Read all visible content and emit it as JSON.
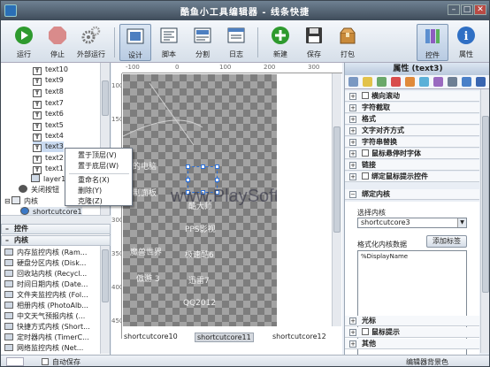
{
  "window": {
    "title": "酷鱼小工具编辑器 - 线条快捷",
    "min": "–",
    "max": "□",
    "close": "✕"
  },
  "toolbar": {
    "run": "运行",
    "stop": "停止",
    "external_run": "外部运行",
    "design": "设计",
    "script": "脚本",
    "split": "分割",
    "log": "日志",
    "new": "新建",
    "save": "保存",
    "pack": "打包",
    "controls": "控件",
    "properties": "属性",
    "colors": {
      "run": "#2e9a2e",
      "stop": "#d64040",
      "new": "#2e9a2e"
    }
  },
  "tree": {
    "items": [
      "text10",
      "text9",
      "text8",
      "text7",
      "text6",
      "text5",
      "text4",
      "text3",
      "text2",
      "text1"
    ],
    "layer": "layer1",
    "close_btn": "关闭按钮",
    "core_group": "内核",
    "core_item": "shortcutcore1"
  },
  "context_menu": {
    "top": "置于顶层(V)",
    "bottom": "置于底层(W)",
    "rename": "重命名(X)",
    "delete": "删除(Y)",
    "clone": "克隆(Z)"
  },
  "left_groups": {
    "controls": "控件",
    "cores": "内核"
  },
  "cores": [
    "内存监控内核 (Ram...",
    "硬盘分区内核 (Disk...",
    "回收站内核 (Recycl...",
    "时间日期内核 (Date...",
    "文件夹监控内核 (Fol...",
    "相册内核 (PhotoAlb...",
    "中文天气预报内核 (...",
    "快捷方式内核 (Short...",
    "定时器内核 (TimerC...",
    "网络监控内核 (Net..."
  ],
  "rulers": {
    "h": [
      "-100",
      "0",
      "100",
      "200",
      "300"
    ],
    "v": [
      "100",
      "150",
      "200",
      "250",
      "300",
      "350",
      "400",
      "450"
    ]
  },
  "canvas_texts": [
    "我的电脑",
    "控制面板",
    "魔兽世界",
    "傲游 3",
    "酷大师",
    "PPS影视",
    "极速酷6",
    "迅雷7",
    "QQ2012"
  ],
  "bottom_items": [
    "shortcutcore10",
    "shortcutcore11",
    "shortcutcore12"
  ],
  "watermark": "www.PlaySoft.com",
  "properties": {
    "title": "属性 (text3)",
    "rows": [
      "横向滚动",
      "字符截取",
      "格式",
      "文字对齐方式",
      "字符串替换",
      "鼠标悬停时字体",
      "链接",
      "绑定鼠标提示控件",
      "绑定内核"
    ],
    "checkbox_rows": [
      "横向滚动",
      "鼠标悬停时字体",
      "绑定鼠标提示控件"
    ],
    "select_core_label": "选择内核",
    "select_core_value": "shortcutcore3",
    "format_label": "格式化内核数据",
    "add_tag_btn": "添加标签",
    "format_value": "%DisplayName",
    "bottom_rows": [
      "光标",
      "鼠标提示",
      "其他"
    ]
  },
  "status": {
    "autosave": "自动保存",
    "bg_color": "编辑器背景色"
  }
}
